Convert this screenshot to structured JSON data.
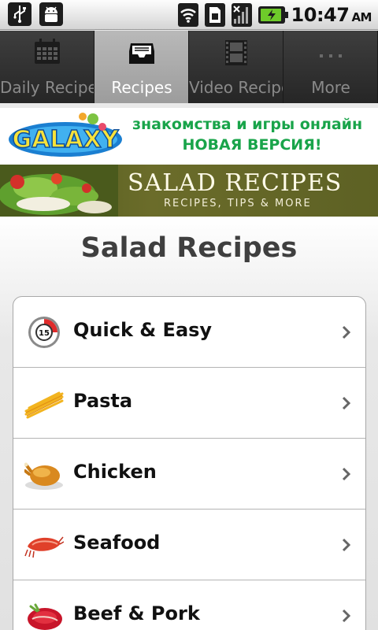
{
  "status_bar": {
    "time": "10:47",
    "ampm": "AM",
    "icons": [
      "usb-icon",
      "android-debug-icon",
      "wifi-icon",
      "sim-icon",
      "signal-icon",
      "battery-icon"
    ],
    "battery_color": "#6ecb2a"
  },
  "tabs": [
    {
      "label": "Daily Recipes",
      "icon": "calendar-icon",
      "active": false
    },
    {
      "label": "Recipes",
      "icon": "inbox-tray-icon",
      "active": true
    },
    {
      "label": "Video Recipe",
      "icon": "film-strip-icon",
      "active": false
    },
    {
      "label": "More",
      "icon": "more-dots-icon",
      "active": false
    }
  ],
  "ad_galaxy": {
    "logo_text": "GALAXY",
    "line1": "знакомства и игры онлайн",
    "line2": "НОВАЯ ВЕРСИЯ!",
    "text_color": "#19a44a"
  },
  "ad_salad": {
    "title": "SALAD RECIPES",
    "subtitle": "RECIPES, TIPS & MORE"
  },
  "page": {
    "title": "Salad Recipes"
  },
  "categories": [
    {
      "label": "Quick & Easy",
      "icon": "stopwatch-15-icon",
      "icon_text": "15"
    },
    {
      "label": "Pasta",
      "icon": "pasta-icon"
    },
    {
      "label": "Chicken",
      "icon": "roast-chicken-icon"
    },
    {
      "label": "Seafood",
      "icon": "shrimp-icon"
    },
    {
      "label": "Beef & Pork",
      "icon": "steak-icon"
    }
  ]
}
